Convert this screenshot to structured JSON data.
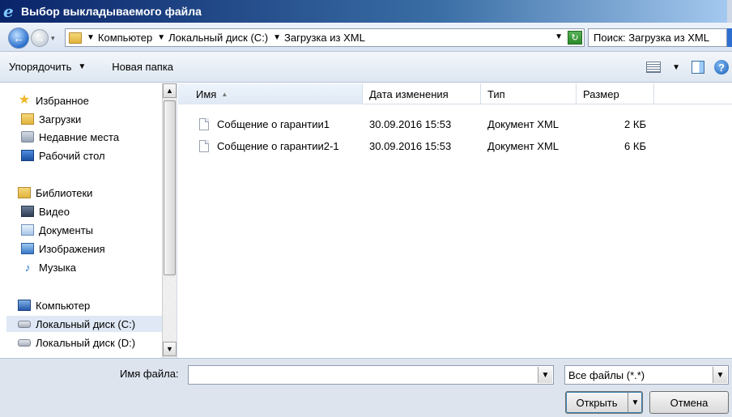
{
  "window": {
    "title": "Выбор выкладываемого файла",
    "icon": "ie-icon"
  },
  "navigation": {
    "breadcrumbs": [
      "Компьютер",
      "Локальный диск (C:)",
      "Загрузка из XML"
    ],
    "search_placeholder": "Поиск: Загрузка из XML"
  },
  "toolbar": {
    "organize_label": "Упорядочить",
    "new_folder_label": "Новая папка"
  },
  "sidebar": {
    "favorites": {
      "label": "Избранное",
      "items": [
        "Загрузки",
        "Недавние места",
        "Рабочий стол"
      ]
    },
    "libraries": {
      "label": "Библиотеки",
      "items": [
        "Видео",
        "Документы",
        "Изображения",
        "Музыка"
      ]
    },
    "computer": {
      "label": "Компьютер",
      "items": [
        "Локальный диск (C:)",
        "Локальный диск (D:)"
      ],
      "selected": "Локальный диск (C:)"
    }
  },
  "file_list": {
    "columns": [
      "Имя",
      "Дата изменения",
      "Тип",
      "Размер"
    ],
    "sort_column": "Имя",
    "rows": [
      {
        "name": "Собщение о гарантии1",
        "date": "30.09.2016 15:53",
        "type": "Документ XML",
        "size": "2 КБ"
      },
      {
        "name": "Собщение о гарантии2-1",
        "date": "30.09.2016 15:53",
        "type": "Документ XML",
        "size": "6 КБ"
      }
    ]
  },
  "footer": {
    "filename_label": "Имя файла:",
    "filename_value": "",
    "filter_value": "Все файлы (*.*)",
    "open_label": "Открыть",
    "cancel_label": "Отмена"
  }
}
